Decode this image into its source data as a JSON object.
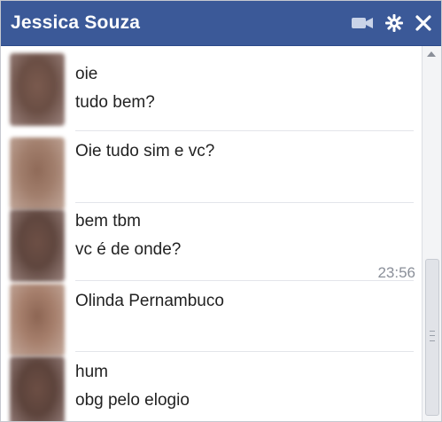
{
  "chat": {
    "title": "Jessica Souza",
    "icons": {
      "video": "video-camera-icon",
      "settings": "gear-icon",
      "close": "close-icon"
    },
    "colors": {
      "header_bg": "#3b5998",
      "text": "#222222",
      "timestamp": "#8a8f99"
    },
    "timestamp": "23:56",
    "messages": [
      {
        "lines": [
          "oie",
          "tudo bem?"
        ]
      },
      {
        "lines": [
          "Oie tudo sim  e vc?"
        ]
      },
      {
        "lines": [
          "bem tbm",
          "vc é de onde?"
        ]
      },
      {
        "lines": [
          "Olinda Pernambuco"
        ]
      },
      {
        "lines": [
          "hum",
          "obg pelo elogio"
        ]
      }
    ]
  }
}
